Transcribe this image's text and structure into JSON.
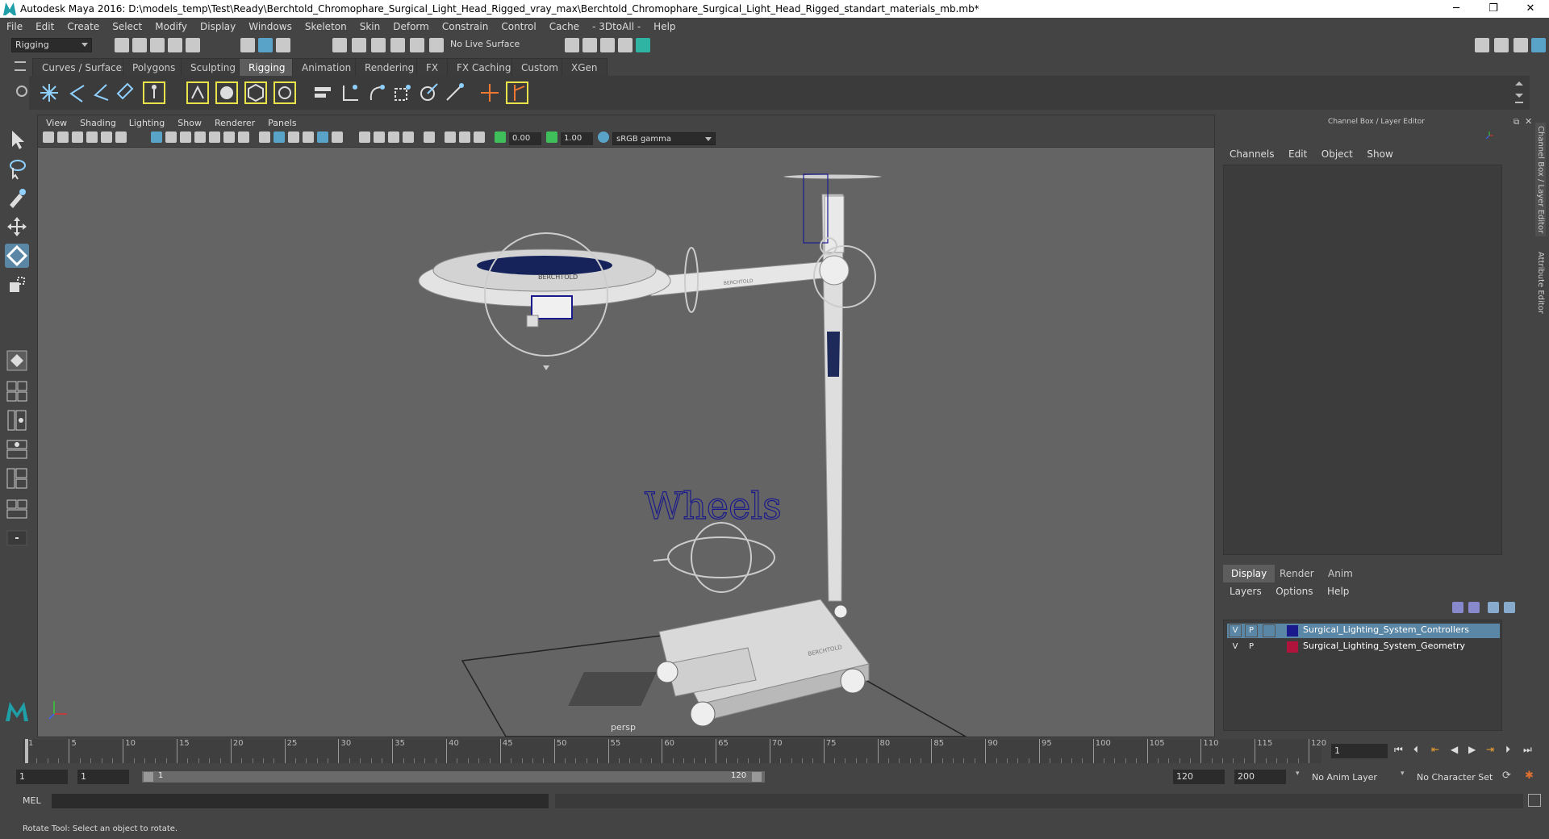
{
  "window": {
    "title": "Autodesk Maya 2016: D:\\models_temp\\Test\\Ready\\Berchtold_Chromophare_Surgical_Light_Head_Rigged_vray_max\\Berchtold_Chromophare_Surgical_Light_Head_Rigged_standart_materials_mb.mb*",
    "minimize": "─",
    "maximize": "❐",
    "close": "✕"
  },
  "menubar": [
    "File",
    "Edit",
    "Create",
    "Select",
    "Modify",
    "Display",
    "Windows",
    "Skeleton",
    "Skin",
    "Deform",
    "Constrain",
    "Control",
    "Cache",
    "- 3DtoAll -",
    "Help"
  ],
  "statusline": {
    "mode": "Rigging",
    "live_surface": "No Live Surface"
  },
  "shelf_tabs": [
    "Curves / Surfaces",
    "Polygons",
    "Sculpting",
    "Rigging",
    "Animation",
    "Rendering",
    "FX",
    "FX Caching",
    "Custom",
    "XGen"
  ],
  "shelf_active": "Rigging",
  "viewport": {
    "menu": [
      "View",
      "Shading",
      "Lighting",
      "Show",
      "Renderer",
      "Panels"
    ],
    "near_value": "0.00",
    "far_value": "1.00",
    "color_space": "sRGB gamma",
    "camera_label": "persp",
    "scene_text": "Wheels",
    "brand_label": "BERCHTOLD"
  },
  "channel_box": {
    "header": "Channel Box / Layer Editor",
    "menu": [
      "Channels",
      "Edit",
      "Object",
      "Show"
    ]
  },
  "layer_editor": {
    "tabs": [
      "Display",
      "Render",
      "Anim"
    ],
    "active_tab": "Display",
    "menu": [
      "Layers",
      "Options",
      "Help"
    ],
    "layers": [
      {
        "v": "V",
        "p": "P",
        "name": "Surgical_Lighting_System_Controllers",
        "color": "#1a1a8c",
        "selected": true
      },
      {
        "v": "V",
        "p": "P",
        "name": "Surgical_Lighting_System_Geometry",
        "color": "#b0143c",
        "selected": false
      }
    ]
  },
  "side_tabs": [
    "Channel Box / Layer Editor",
    "Attribute Editor"
  ],
  "timeline": {
    "current_frame": "1",
    "ticks": [
      "1",
      "5",
      "10",
      "15",
      "20",
      "25",
      "30",
      "35",
      "40",
      "45",
      "50",
      "55",
      "60",
      "65",
      "70",
      "75",
      "80",
      "85",
      "90",
      "95",
      "100",
      "105",
      "110",
      "115",
      "120"
    ],
    "range_start": "1",
    "range_start_inner": "1",
    "slider_start": "1",
    "slider_end": "120",
    "range_end": "120",
    "anim_end": "200",
    "anim_layer": "No Anim Layer",
    "character_set": "No Character Set"
  },
  "command_line": {
    "label": "MEL"
  },
  "help_line": "Rotate Tool: Select an object to rotate."
}
